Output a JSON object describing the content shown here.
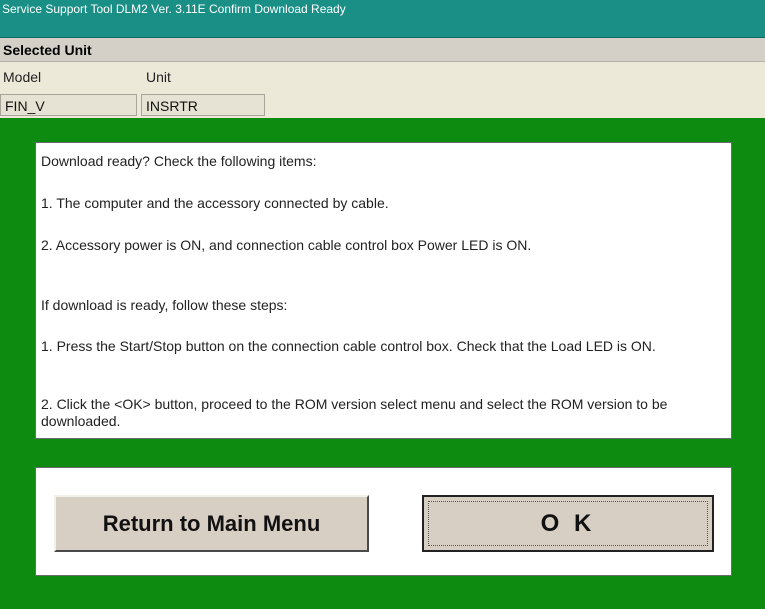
{
  "window": {
    "title": "Service Support Tool DLM2 Ver. 3.11E  Confirm Download Ready"
  },
  "selected_unit": {
    "header": "Selected Unit",
    "columns": [
      "Model",
      "Unit"
    ],
    "values": [
      "FIN_V",
      "INSRTR"
    ]
  },
  "message": {
    "lines": [
      "Download ready? Check the following items:",
      "1. The computer and the accessory connected by cable.",
      "2. Accessory power is ON, and connection cable control box Power LED is ON.",
      "If download is ready, follow these steps:",
      "1. Press the Start/Stop button on the connection cable control box. Check that the Load LED is ON.",
      "2. Click the <OK> button, proceed to the ROM version select menu and select the ROM version to be downloaded."
    ]
  },
  "buttons": {
    "return_label": "Return to Main Menu",
    "ok_label": "O K"
  },
  "colors": {
    "titlebar": "#1a8f86",
    "panel_green": "#0d8a10",
    "button_face": "#d8cfc4"
  }
}
